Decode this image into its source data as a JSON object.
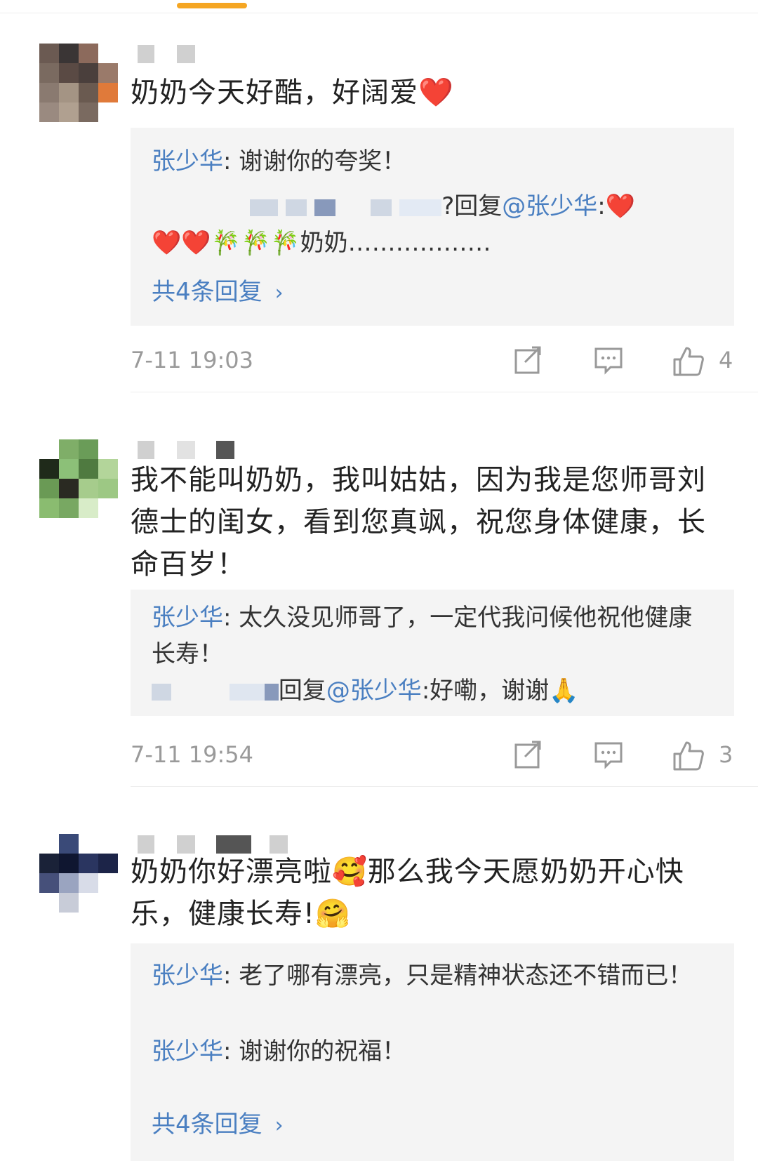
{
  "comments": [
    {
      "text": "奶奶今天好酷，好阔爱❤️",
      "replies": [
        {
          "name": "张少华",
          "sep": ":",
          "body": " 谢谢你的夸奖！"
        },
        {
          "mid": "?回复",
          "mention": "@张少华",
          "sep": ":",
          "emojis": "❤️",
          "line2": "❤️❤️🎋🎋🎋奶奶………………"
        }
      ],
      "more": "共4条回复",
      "time": "7-11 19:03",
      "likes": "4"
    },
    {
      "text": "我不能叫奶奶，我叫姑姑，因为我是您师哥刘德士的闺女，看到您真飒，祝您身体健康，长命百岁！",
      "replies": [
        {
          "name": "张少华",
          "sep": ":",
          "body": " 太久没见师哥了，一定代我问候他祝他健康长寿！"
        },
        {
          "mid": "回复",
          "mention": "@张少华",
          "sep": ":",
          "body": "好嘞，谢谢🙏"
        }
      ],
      "time": "7-11 19:54",
      "likes": "3"
    },
    {
      "text": "奶奶你好漂亮啦🥰那么我今天愿奶奶开心快乐，健康长寿!🤗",
      "replies": [
        {
          "name": "张少华",
          "sep": ":",
          "body": " 老了哪有漂亮，只是精神状态还不错而已！"
        },
        {
          "name": "张少华",
          "sep": ":",
          "body": " 谢谢你的祝福！"
        }
      ],
      "more": "共4条回复"
    }
  ],
  "icons": {
    "share": "share-icon",
    "comment": "comment-icon",
    "like": "thumbs-up-icon"
  },
  "colors": {
    "link": "#4a7fc1",
    "reply_bg": "#f4f4f4",
    "tab_accent": "#f5a623",
    "meta": "#9a9a9a"
  }
}
